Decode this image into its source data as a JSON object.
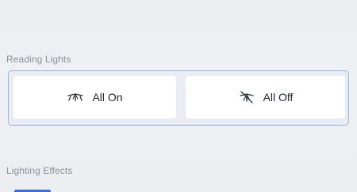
{
  "reading_lights": {
    "section_label": "Reading Lights",
    "all_on_label": "All On",
    "all_off_label": "All Off",
    "all_on_icon": "lamp-on-icon",
    "all_off_icon": "lamp-off-icon"
  },
  "lighting_effects": {
    "section_label": "Lighting Effects"
  },
  "colors": {
    "accent": "#3a6fd8",
    "group_border": "#9fb2d8",
    "label_text": "#8b9099"
  }
}
